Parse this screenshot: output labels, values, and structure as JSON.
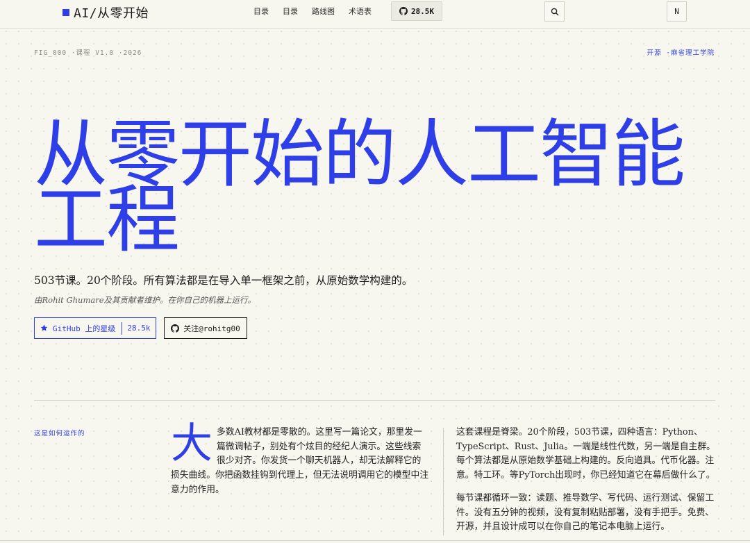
{
  "nav": {
    "brand": "AI/从零开始",
    "links": [
      "目录",
      "目录",
      "路线图",
      "术语表"
    ],
    "github_stars": "28.5K",
    "search_icon": "search-icon",
    "user_initial": "N"
  },
  "meta": {
    "left": "FIG_000 ·课程 V1.0 ·2026",
    "right": "开源 ·麻省理工学院"
  },
  "hero": {
    "title": "从零开始的人工智能工程",
    "subtitle": "503节课。20个阶段。所有算法都是在导入单一框架之前，从原始数学构建的。",
    "byline": "由Rohit Ghumare及其贡献者维护。在你自己的机器上运行。",
    "star_button": "GitHub 上的星级",
    "star_count": "28.5k",
    "follow_button": "关注@rohitg00"
  },
  "section": {
    "label": "这是如何运作的",
    "dropcap": "大",
    "col1": "多数AI教材都是零散的。这里写一篇论文，那里发一篇微调帖子，别处有个炫目的经纪人演示。这些线索很少对齐。你发货一个聊天机器人，却无法解释它的损失曲线。你把函数挂钩到代理上，但无法说明调用它的模型中注意力的作用。",
    "col2_p1": "这套课程是脊梁。20个阶段，503节课，四种语言：Python、TypeScript、Rust、Julia。一端是线性代数，另一端是自主群。每个算法都是从原始数学基础上构建的。反向道具。代币化器。注意。特工环。等PyTorch出现时，你已经知道它在幕后做什么了。",
    "col2_p2": "每节课都循环一致：读题、推导数学、写代码、运行测试、保留工件。没有五分钟的视频，没有复制粘贴部署，没有手把手。免费、开源，并且设计成可以在你自己的笔记本电脑上运行。"
  },
  "colors": {
    "accent": "#2e3fe8",
    "background": "#f7f6ef"
  }
}
